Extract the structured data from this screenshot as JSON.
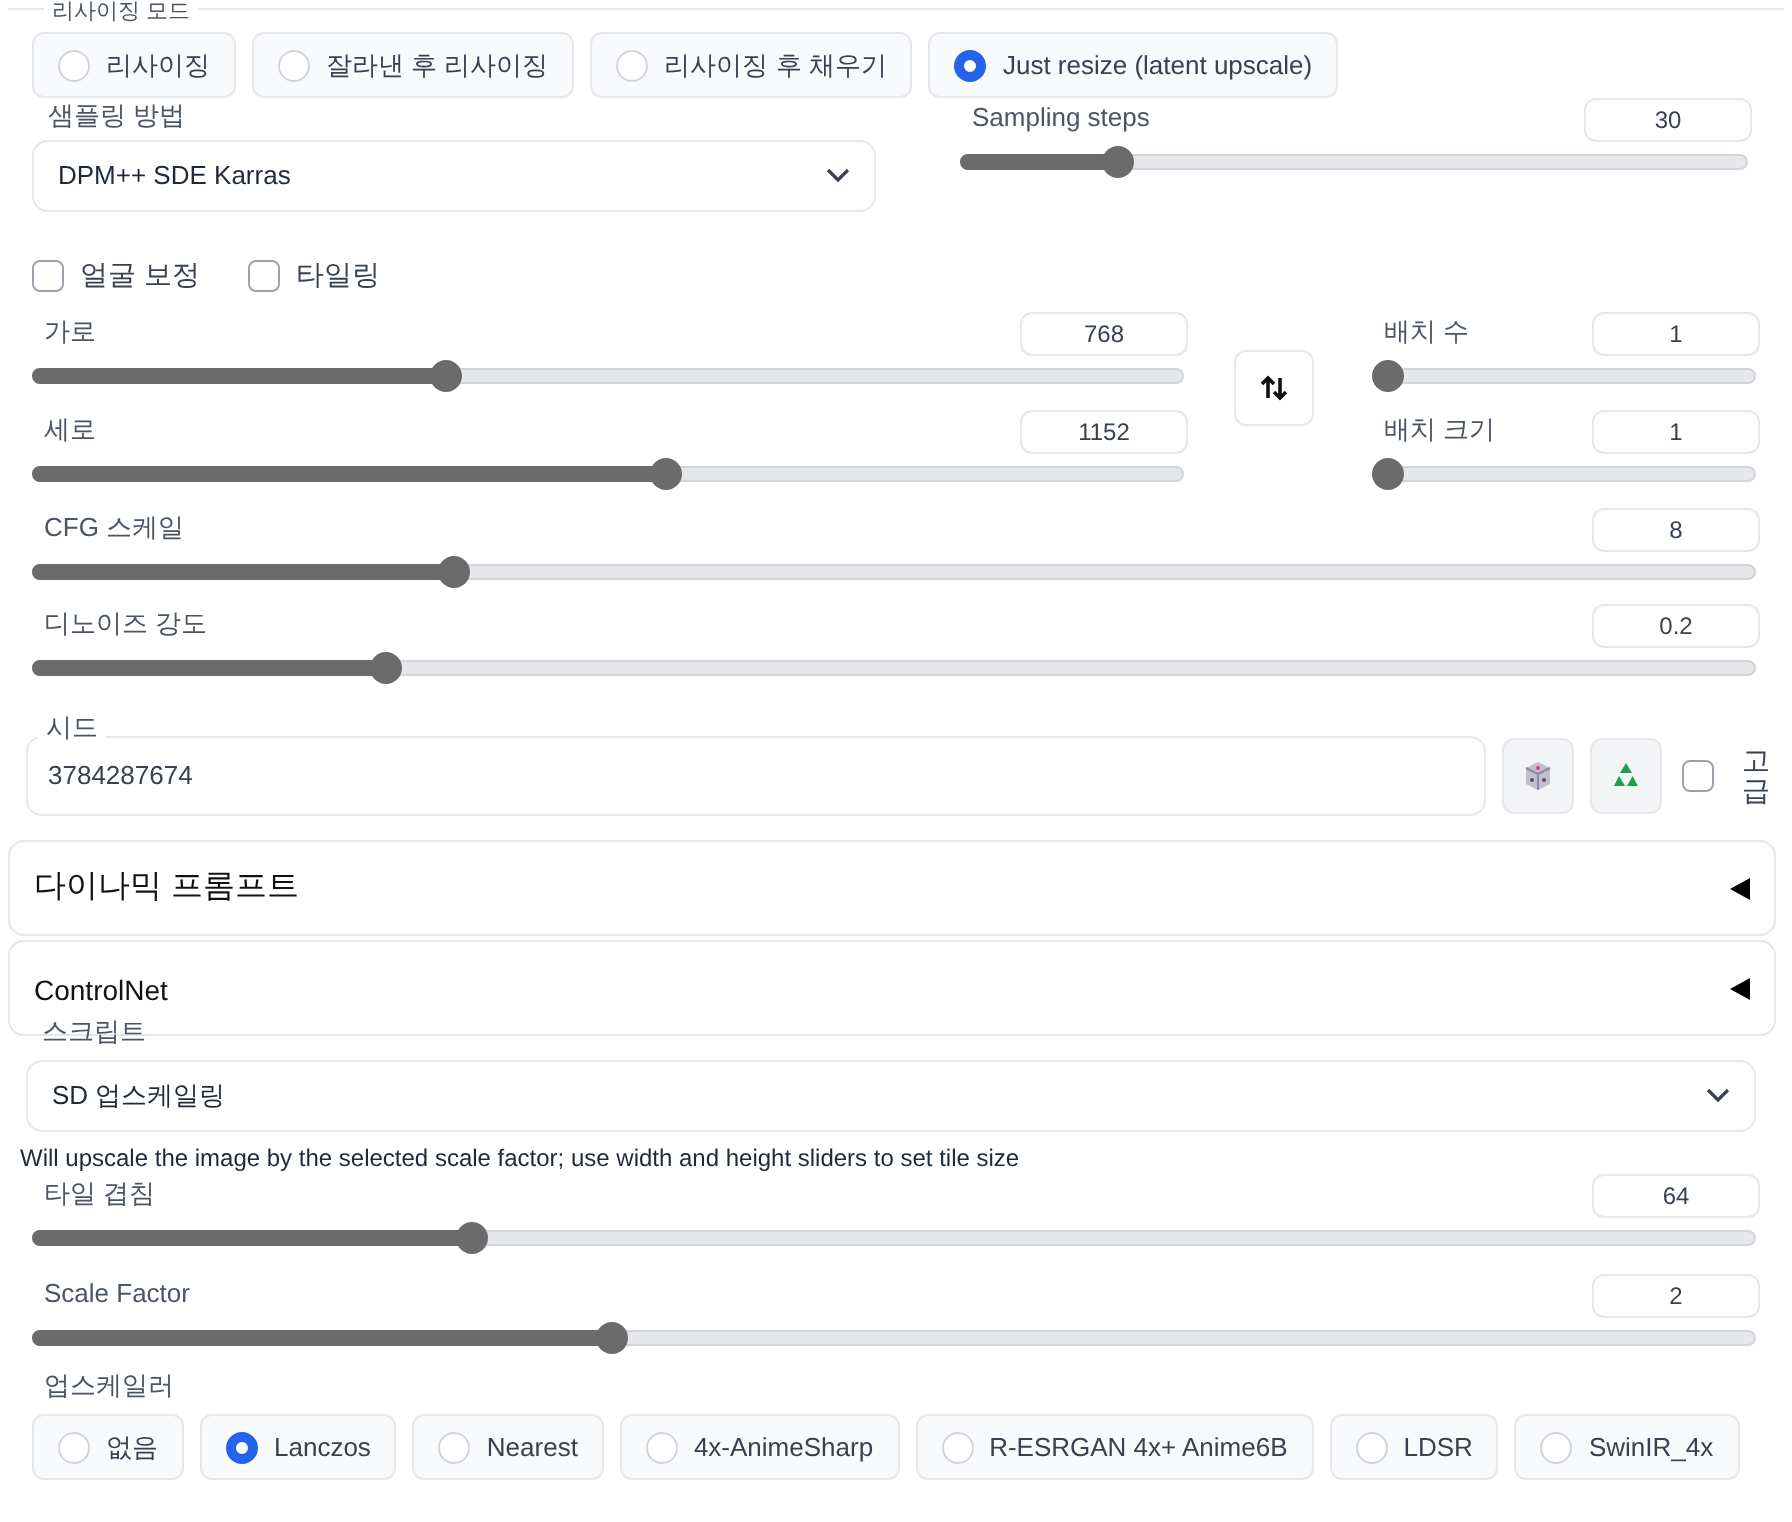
{
  "resize_mode": {
    "label": "리사이징 모드",
    "options": [
      {
        "label": "리사이징",
        "selected": false
      },
      {
        "label": "잘라낸 후 리사이징",
        "selected": false
      },
      {
        "label": "리사이징 후 채우기",
        "selected": false
      },
      {
        "label": "Just resize (latent upscale)",
        "selected": true
      }
    ]
  },
  "sampling_method": {
    "label": "샘플링 방법",
    "value": "DPM++ SDE Karras"
  },
  "sampling_steps": {
    "label": "Sampling steps",
    "value": "30",
    "level": 0.2
  },
  "checkboxes": [
    {
      "label": "얼굴 보정",
      "checked": false
    },
    {
      "label": "타일링",
      "checked": false
    }
  ],
  "width": {
    "label": "가로",
    "value": "768",
    "level": 0.36
  },
  "height": {
    "label": "세로",
    "value": "1152",
    "level": 0.55
  },
  "batch_count": {
    "label": "배치 수",
    "value": "1",
    "level": 0
  },
  "batch_size": {
    "label": "배치 크기",
    "value": "1",
    "level": 0
  },
  "cfg_scale": {
    "label": "CFG 스케일",
    "value": "8",
    "level": 0.245
  },
  "denoising": {
    "label": "디노이즈 강도",
    "value": "0.2",
    "level": 0.205
  },
  "seed": {
    "label": "시드",
    "value": "3784287674",
    "advanced_label": "고급",
    "advanced_checked": false
  },
  "accordions": [
    {
      "label": "다이나믹 프롬프트",
      "expanded": false
    },
    {
      "label": "ControlNet",
      "expanded": false
    }
  ],
  "script": {
    "label": "스크립트",
    "value": "SD 업스케일링",
    "description": "Will upscale the image by the selected scale factor; use width and height sliders to set tile size"
  },
  "tile_overlap": {
    "label": "타일 겹침",
    "value": "64",
    "level": 0.255
  },
  "scale_factor": {
    "label": "Scale Factor",
    "value": "2",
    "level": 0.336
  },
  "upscaler": {
    "label": "업스케일러",
    "options": [
      {
        "label": "없음",
        "selected": false
      },
      {
        "label": "Lanczos",
        "selected": true
      },
      {
        "label": "Nearest",
        "selected": false
      },
      {
        "label": "4x-AnimeSharp",
        "selected": false
      },
      {
        "label": "R-ESRGAN 4x+ Anime6B",
        "selected": false
      },
      {
        "label": "LDSR",
        "selected": false
      },
      {
        "label": "SwinIR_4x",
        "selected": false
      }
    ]
  }
}
